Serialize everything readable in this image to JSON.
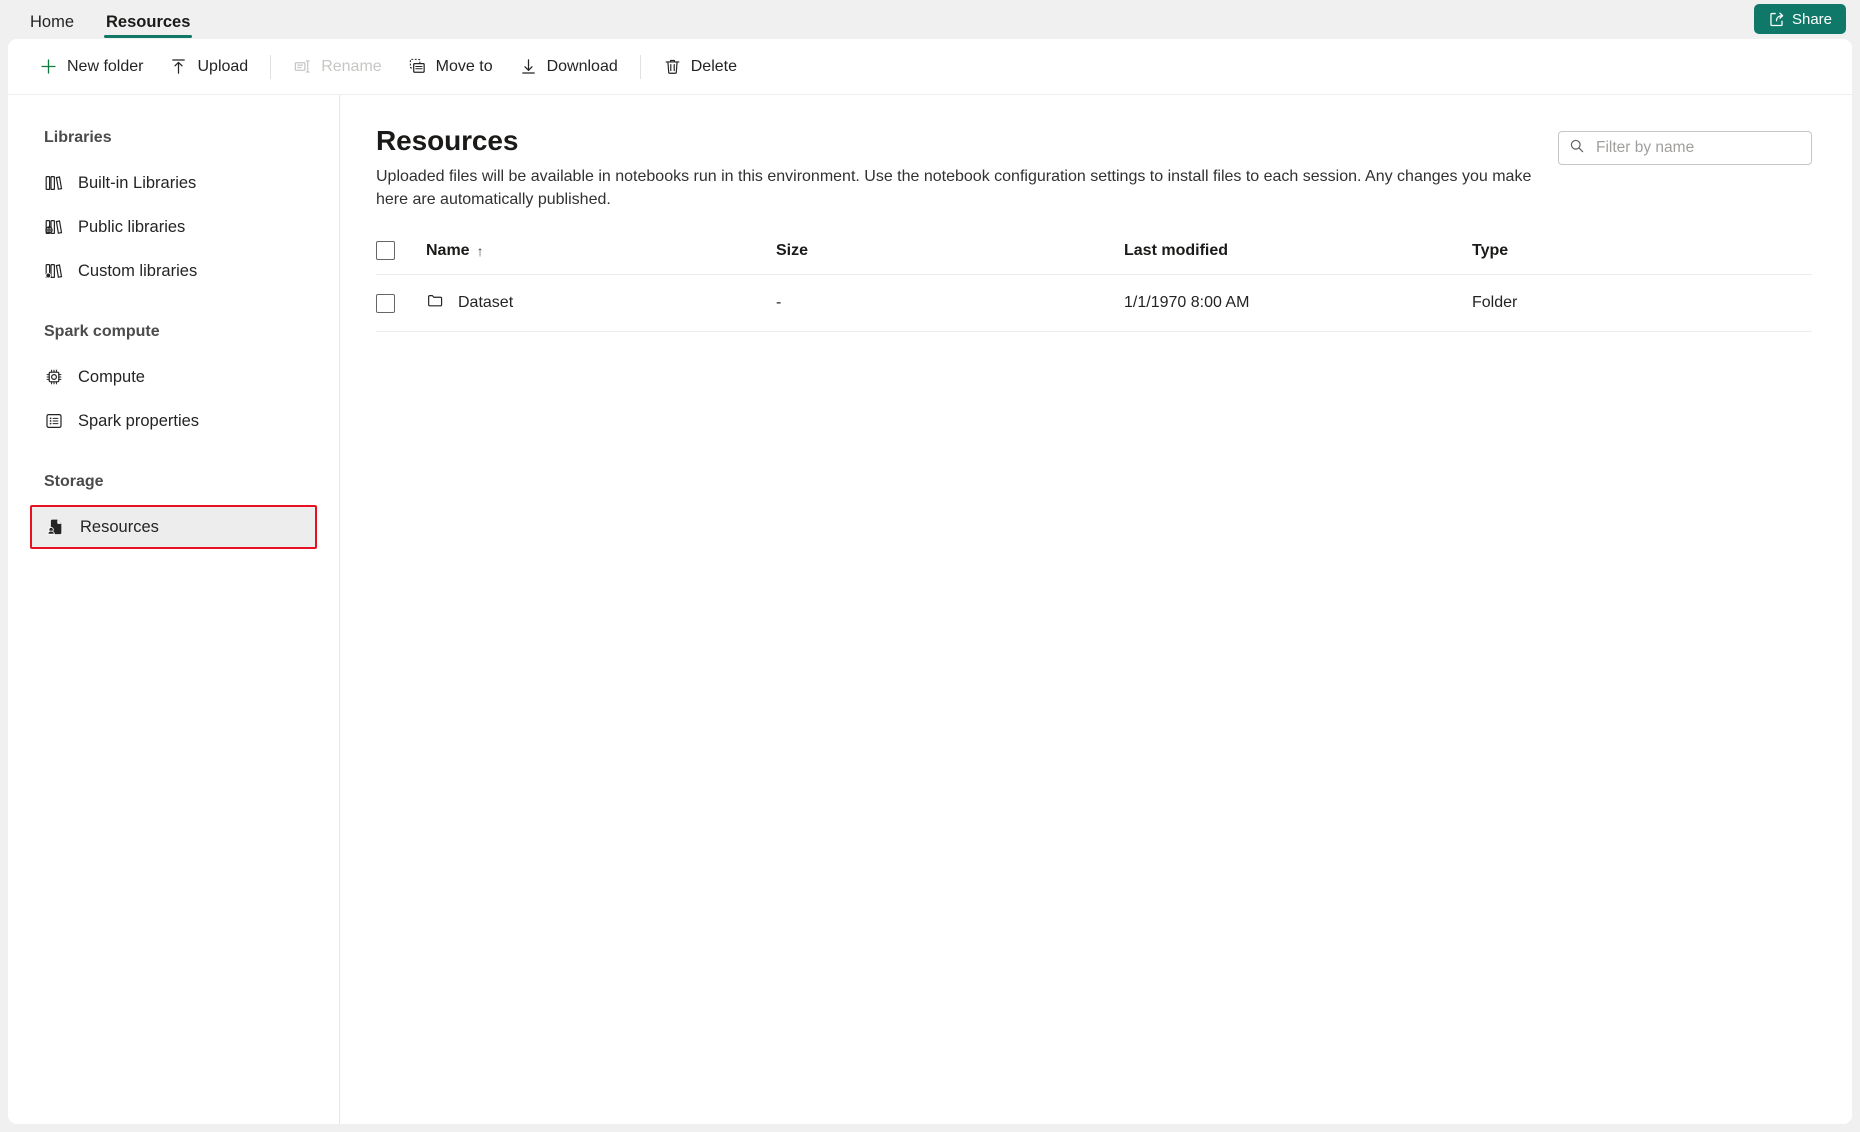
{
  "topbar": {
    "tabs": [
      {
        "label": "Home",
        "active": false
      },
      {
        "label": "Resources",
        "active": true
      }
    ],
    "share_label": "Share",
    "share_color": "#107869",
    "accent_color": "#117865"
  },
  "toolbar": {
    "new_folder_label": "New folder",
    "upload_label": "Upload",
    "rename_label": "Rename",
    "move_to_label": "Move to",
    "download_label": "Download",
    "delete_label": "Delete",
    "new_folder_icon_color": "#0f7b3e"
  },
  "sidebar": {
    "groups": [
      {
        "title": "Libraries",
        "items": [
          {
            "label": "Built-in Libraries",
            "icon": "books-icon",
            "selected": false
          },
          {
            "label": "Public libraries",
            "icon": "public-books-icon",
            "selected": false
          },
          {
            "label": "Custom libraries",
            "icon": "custom-books-icon",
            "selected": false
          }
        ]
      },
      {
        "title": "Spark compute",
        "items": [
          {
            "label": "Compute",
            "icon": "chip-icon",
            "selected": false
          },
          {
            "label": "Spark properties",
            "icon": "list-icon",
            "selected": false
          }
        ]
      },
      {
        "title": "Storage",
        "items": [
          {
            "label": "Resources",
            "icon": "resources-icon",
            "selected": true
          }
        ]
      }
    ],
    "selection_outline_color": "#e81123"
  },
  "main": {
    "title": "Resources",
    "description": "Uploaded files will be available in notebooks run in this environment. Use the notebook configuration settings to install files to each session. Any changes you make here are automatically published.",
    "filter": {
      "value": "",
      "placeholder": "Filter by name",
      "icon": "search-icon"
    },
    "table": {
      "columns": [
        "Name",
        "Size",
        "Last modified",
        "Type"
      ],
      "sorted_column": "Name",
      "sort_direction": "ascending",
      "sort_glyph": "↑",
      "rows": [
        {
          "name": "Dataset",
          "size": "-",
          "last_modified": "1/1/1970 8:00 AM",
          "type": "Folder",
          "icon": "folder-icon",
          "checked": false
        }
      ]
    }
  }
}
